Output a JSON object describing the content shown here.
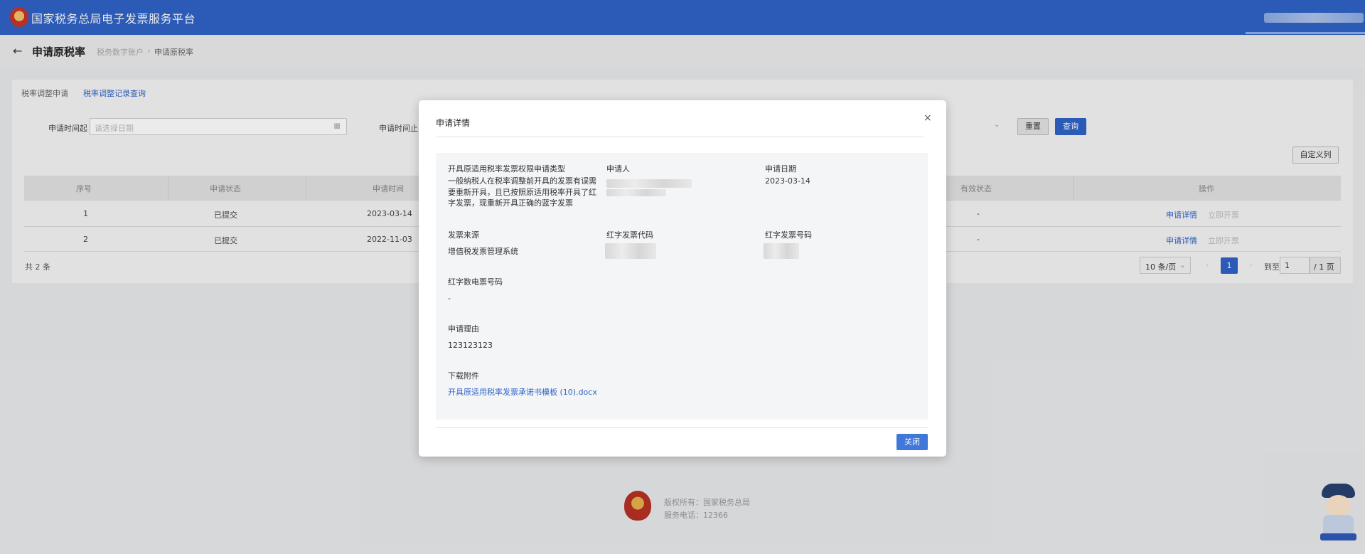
{
  "header": {
    "title": "国家税务总局电子发票服务平台"
  },
  "subheader": {
    "page_title": "申请原税率",
    "breadcrumb": [
      "税务数字账户",
      "申请原税率"
    ],
    "breadcrumb_sep": "›"
  },
  "tabs": [
    {
      "label": "税率调整申请"
    },
    {
      "label": "税率调整记录查询"
    }
  ],
  "filters": {
    "start_label": "申请时间起",
    "start_placeholder": "请选择日期",
    "end_label": "申请时间止",
    "reset": "重置",
    "query": "查询",
    "custom_columns": "自定义列"
  },
  "table": {
    "headers": [
      "序号",
      "申请状态",
      "申请时间",
      "有效状态",
      "操作"
    ],
    "rows": [
      {
        "index": "1",
        "status": "已提交",
        "time": "2023-03-14",
        "valid": "-",
        "action1": "申请详情",
        "action2": "立即开票"
      },
      {
        "index": "2",
        "status": "已提交",
        "time": "2022-11-03",
        "valid": "-",
        "action1": "申请详情",
        "action2": "立即开票"
      }
    ]
  },
  "pagination": {
    "total": "共 2 条",
    "page_size": "10 条/页",
    "current": "1",
    "goto_label": "到至",
    "goto_value": "1",
    "total_pages": "/ 1 页",
    "prev": "‹",
    "next": "›"
  },
  "footer": {
    "copyright": "版权所有：国家税务总局",
    "phone": "服务电话：12366"
  },
  "modal": {
    "title": "申请详情",
    "close_icon": "×",
    "fields": {
      "type_label": "开具原适用税率发票权限申请类型",
      "type_value": "一般纳税人在税率调整前开具的发票有误需要重新开具，且已按照原适用税率开具了红字发票，现重新开具正确的蓝字发票",
      "applicant_label": "申请人",
      "date_label": "申请日期",
      "date_value": "2023-03-14",
      "source_label": "发票来源",
      "source_value": "增值税发票管理系统",
      "red_code_label": "红字发票代码",
      "red_number_label": "红字发票号码",
      "red_einvoice_label": "红字数电票号码",
      "red_einvoice_value": "-",
      "reason_label": "申请理由",
      "reason_value": "123123123",
      "attachment_label": "下载附件",
      "attachment_value": "开具原适用税率发票承诺书模板 (10).docx"
    },
    "close_button": "关闭"
  },
  "colors": {
    "primary": "#2f63c6",
    "header_bg": "#2f63c6",
    "button_blue": "#3f78d8"
  }
}
